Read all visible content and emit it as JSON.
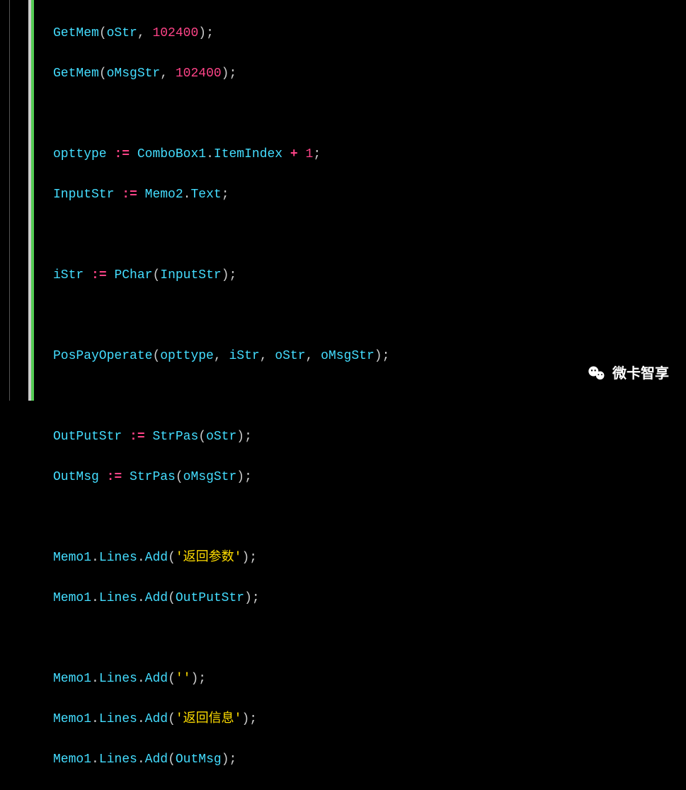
{
  "code": {
    "line1": {
      "fn": "GetMem",
      "arg1": "oStr",
      "arg2": "102400"
    },
    "line2": {
      "fn": "GetMem",
      "arg1": "oMsgStr",
      "arg2": "102400"
    },
    "line3": {
      "lhs": "opttype",
      "assign": ":=",
      "rhs1": "ComboBox1",
      "dot": ".",
      "rhs2": "ItemIndex",
      "plus": "+",
      "num": "1"
    },
    "line4": {
      "lhs": "InputStr",
      "assign": ":=",
      "rhs1": "Memo2",
      "dot": ".",
      "rhs2": "Text"
    },
    "line5": {
      "lhs": "iStr",
      "assign": ":=",
      "fn": "PChar",
      "arg": "InputStr"
    },
    "line6": {
      "fn": "PosPayOperate",
      "arg1": "opttype",
      "arg2": "iStr",
      "arg3": "oStr",
      "arg4": "oMsgStr"
    },
    "line7": {
      "lhs": "OutPutStr",
      "assign": ":=",
      "fn": "StrPas",
      "arg": "oStr"
    },
    "line8": {
      "lhs": "OutMsg",
      "assign": ":=",
      "fn": "StrPas",
      "arg": "oMsgStr"
    },
    "line9": {
      "obj": "Memo1",
      "prop": "Lines",
      "method": "Add",
      "str": "'返回参数'"
    },
    "line10": {
      "obj": "Memo1",
      "prop": "Lines",
      "method": "Add",
      "arg": "OutPutStr"
    },
    "line11": {
      "obj": "Memo1",
      "prop": "Lines",
      "method": "Add",
      "str": "''"
    },
    "line12": {
      "obj": "Memo1",
      "prop": "Lines",
      "method": "Add",
      "str": "'返回信息'"
    },
    "line13": {
      "obj": "Memo1",
      "prop": "Lines",
      "method": "Add",
      "arg": "OutMsg"
    }
  },
  "watermark": {
    "text": "微卡智享"
  }
}
